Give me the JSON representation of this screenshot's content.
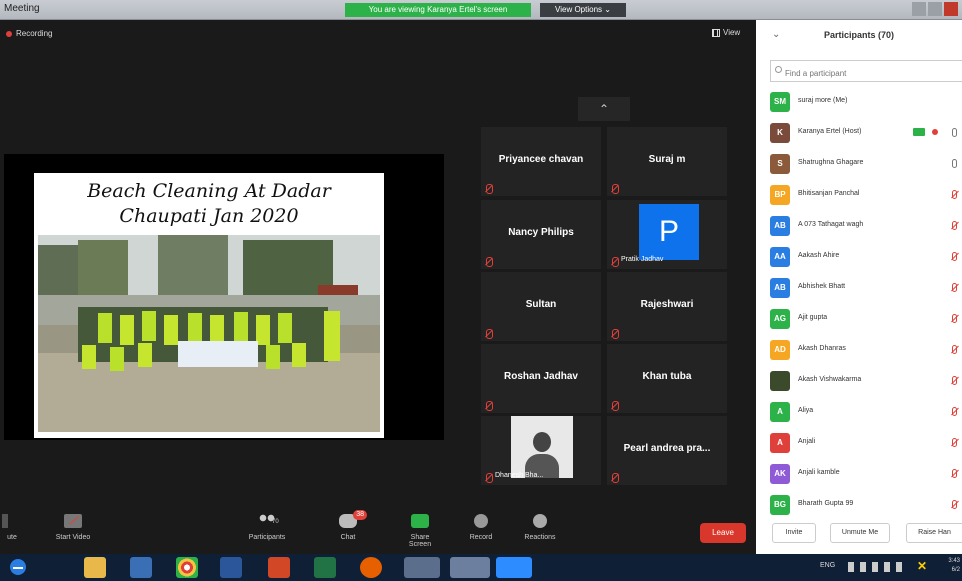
{
  "window": {
    "title": "Meeting",
    "share_banner": "You are viewing Karanya Ertel's screen",
    "view_options": "View Options ⌄"
  },
  "meeting": {
    "recording_label": "Recording",
    "view_label": "View",
    "collapse_icon": "chevron-up-icon"
  },
  "slide": {
    "title_line1": "Beach Cleaning At Dadar",
    "title_line2": "Chaupati  Jan 2020"
  },
  "tiles": [
    {
      "name": "Priyancee chavan",
      "kind": "name"
    },
    {
      "name": "Suraj m",
      "kind": "name"
    },
    {
      "name": "Nancy  Philips",
      "kind": "name"
    },
    {
      "name": "Pratik Jadhav",
      "kind": "avatar",
      "initial": "P"
    },
    {
      "name": "Sultan",
      "kind": "name"
    },
    {
      "name": "Rajeshwari",
      "kind": "name"
    },
    {
      "name": "Roshan Jadhav",
      "kind": "name"
    },
    {
      "name": "Khan tuba",
      "kind": "name"
    },
    {
      "name": "Dhanesh Bha...",
      "kind": "video"
    },
    {
      "name": "Pearl andrea pra...",
      "kind": "name"
    }
  ],
  "toolbar": {
    "unmute_label": "ute",
    "video_label": "Start Video",
    "participants_label": "Participants",
    "participants_count": "70",
    "chat_label": "Chat",
    "chat_badge": "38",
    "share_label": "Share Screen",
    "record_label": "Record",
    "reactions_label": "Reactions",
    "leave_label": "Leave"
  },
  "panel": {
    "title": "Participants (70)",
    "search_placeholder": "Find a participant",
    "participants": [
      {
        "initials": "SM",
        "name": "suraj more (Me)",
        "color": "#2db24a",
        "mic": "none"
      },
      {
        "initials": "K",
        "name": "Karanya Ertel (Host)",
        "color": "#7a4a3a",
        "mic": "on"
      },
      {
        "initials": "S",
        "name": "Shatrughna Ghagare",
        "color": "#8a5a3a",
        "mic": "on"
      },
      {
        "initials": "BP",
        "name": "Bhitisanjan Panchal",
        "color": "#f5a623",
        "mic": "muted"
      },
      {
        "initials": "AB",
        "name": "A  073 Tathagat wagh",
        "color": "#2a7de1",
        "mic": "muted"
      },
      {
        "initials": "AA",
        "name": "Aakash Ahire",
        "color": "#2a7de1",
        "mic": "muted"
      },
      {
        "initials": "AB",
        "name": "Abhishek  Bhatt",
        "color": "#2a7de1",
        "mic": "muted"
      },
      {
        "initials": "AG",
        "name": "Ajit gupta",
        "color": "#2db24a",
        "mic": "muted"
      },
      {
        "initials": "AD",
        "name": "Akash Dhanras",
        "color": "#f5a623",
        "mic": "muted"
      },
      {
        "initials": "",
        "name": "Akash Vishwakarma",
        "color": "#3a4a2a",
        "mic": "muted"
      },
      {
        "initials": "A",
        "name": "Aliya",
        "color": "#2db24a",
        "mic": "muted"
      },
      {
        "initials": "A",
        "name": "Anjali",
        "color": "#e0403a",
        "mic": "muted"
      },
      {
        "initials": "AK",
        "name": "Anjali kamble",
        "color": "#8e5ad6",
        "mic": "muted"
      },
      {
        "initials": "BG",
        "name": "Bharath Gupta 99",
        "color": "#2db24a",
        "mic": "muted"
      }
    ],
    "invite_label": "Invite",
    "unmute_me_label": "Unmute Me",
    "raise_hand_label": "Raise Han"
  },
  "taskbar": {
    "tray_lang": "ENG",
    "clock_time": "3:43",
    "clock_date": "6/2"
  }
}
